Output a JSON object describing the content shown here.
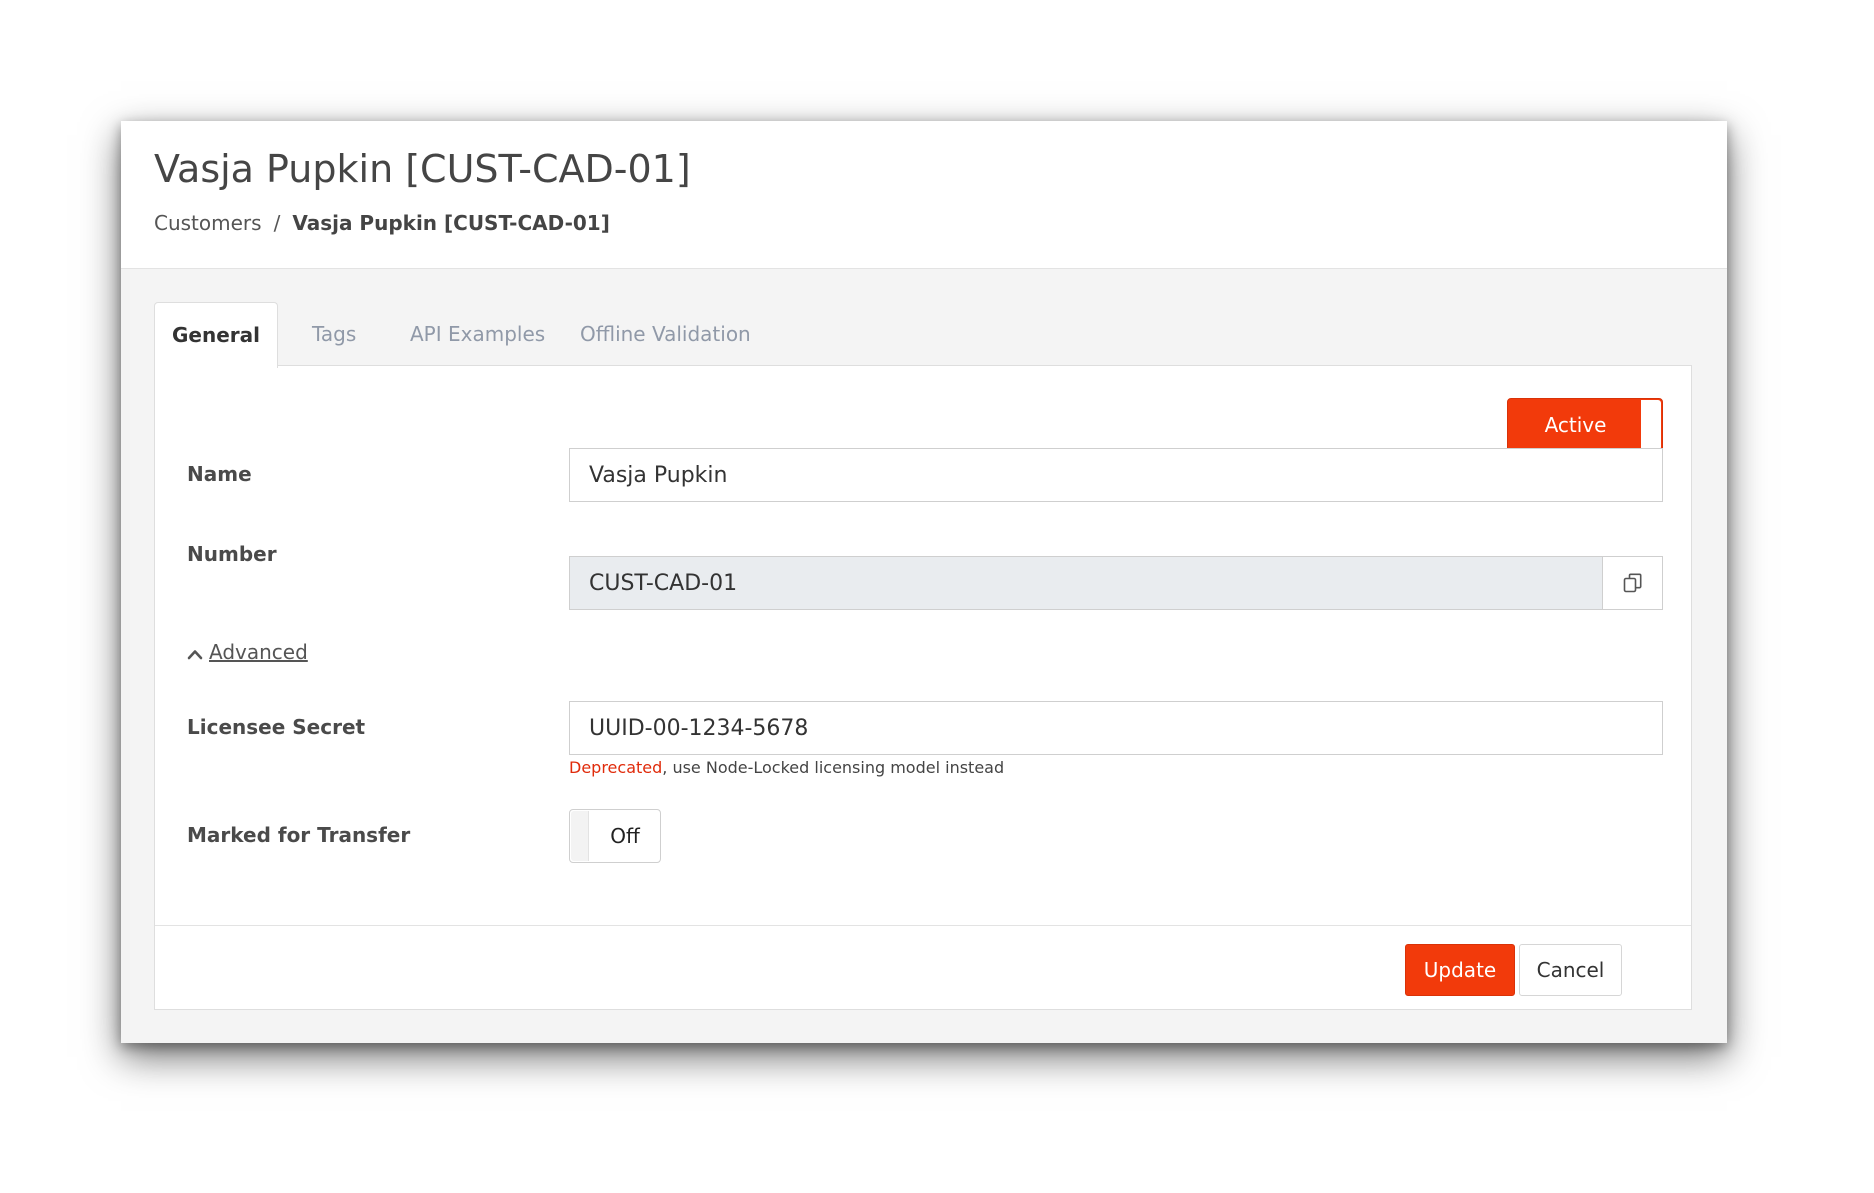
{
  "header": {
    "title": "Vasja Pupkin [CUST-CAD-01]",
    "breadcrumb": {
      "parent": "Customers",
      "separator": "/",
      "current": "Vasja Pupkin [CUST-CAD-01]"
    }
  },
  "tabs": [
    {
      "label": "General",
      "active": true
    },
    {
      "label": "Tags",
      "active": false
    },
    {
      "label": "API Examples",
      "active": false
    },
    {
      "label": "Offline Validation",
      "active": false
    }
  ],
  "status": {
    "label": "Active",
    "on": true,
    "color": "#f23a0b"
  },
  "form": {
    "name": {
      "label": "Name",
      "value": "Vasja Pupkin"
    },
    "number": {
      "label": "Number",
      "value": "CUST-CAD-01",
      "copy_icon": "copy-icon"
    },
    "advanced": {
      "label": "Advanced",
      "expanded": true,
      "icon": "chevron-up-icon"
    },
    "licensee_secret": {
      "label": "Licensee Secret",
      "value": "UUID-00-1234-5678",
      "help_deprecated": "Deprecated",
      "help_rest": ", use Node-Locked licensing model instead"
    },
    "marked_for_transfer": {
      "label": "Marked for Transfer",
      "state": "Off",
      "on": false
    }
  },
  "actions": {
    "update_label": "Update",
    "cancel_label": "Cancel"
  },
  "colors": {
    "accent": "#f23a0b",
    "deprecated": "#e02b0b",
    "inactive_tab": "#9099a8"
  }
}
